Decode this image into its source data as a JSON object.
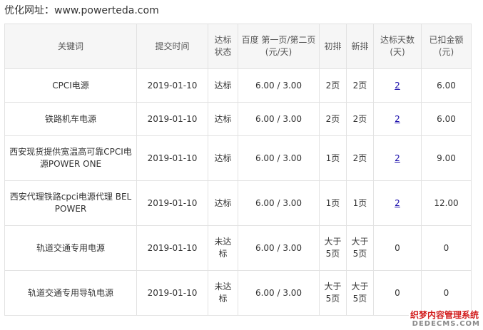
{
  "site": {
    "label": "优化网址：",
    "url": "www.powerteda.com"
  },
  "table": {
    "headers": [
      "关键词",
      "提交时间",
      "达标状态",
      "百度 第一页/第二页(元/天)",
      "初排",
      "新排",
      "达标天数(天)",
      "已扣金额(元)"
    ],
    "rows": [
      {
        "keyword": "CPCI电源",
        "date": "2019-01-10",
        "status": "达标",
        "price": "6.00 / 3.00",
        "initial": "2页",
        "current": "2页",
        "days": "2",
        "amount": "6.00"
      },
      {
        "keyword": "铁路机车电源",
        "date": "2019-01-10",
        "status": "达标",
        "price": "6.00 / 3.00",
        "initial": "2页",
        "current": "2页",
        "days": "2",
        "amount": "6.00"
      },
      {
        "keyword": "西安现货提供宽温高可靠CPCI电源POWER ONE",
        "date": "2019-01-10",
        "status": "达标",
        "price": "6.00 / 3.00",
        "initial": "1页",
        "current": "2页",
        "days": "2",
        "amount": "9.00"
      },
      {
        "keyword": "西安代理铁路cpci电源代理 BEL POWER",
        "date": "2019-01-10",
        "status": "达标",
        "price": "6.00 / 3.00",
        "initial": "1页",
        "current": "1页",
        "days": "2",
        "amount": "12.00"
      },
      {
        "keyword": "轨道交通专用电源",
        "date": "2019-01-10",
        "status": "未达标",
        "price": "6.00 / 3.00",
        "initial": "大于5页",
        "current": "大于5页",
        "days": "0",
        "amount": "0"
      },
      {
        "keyword": "轨道交通专用导轨电源",
        "date": "2019-01-10",
        "status": "未达标",
        "price": "6.00 / 3.00",
        "initial": "大于5页",
        "current": "大于5页",
        "days": "0",
        "amount": "0"
      }
    ]
  },
  "watermark": {
    "cn": "织梦内容管理系统",
    "en": "DEDECMS.COM"
  },
  "colors": {
    "highlight": "#e0211f",
    "link": "#1a0dab",
    "header_bg": "#f6f6f6",
    "border": "#e2e2e2"
  }
}
